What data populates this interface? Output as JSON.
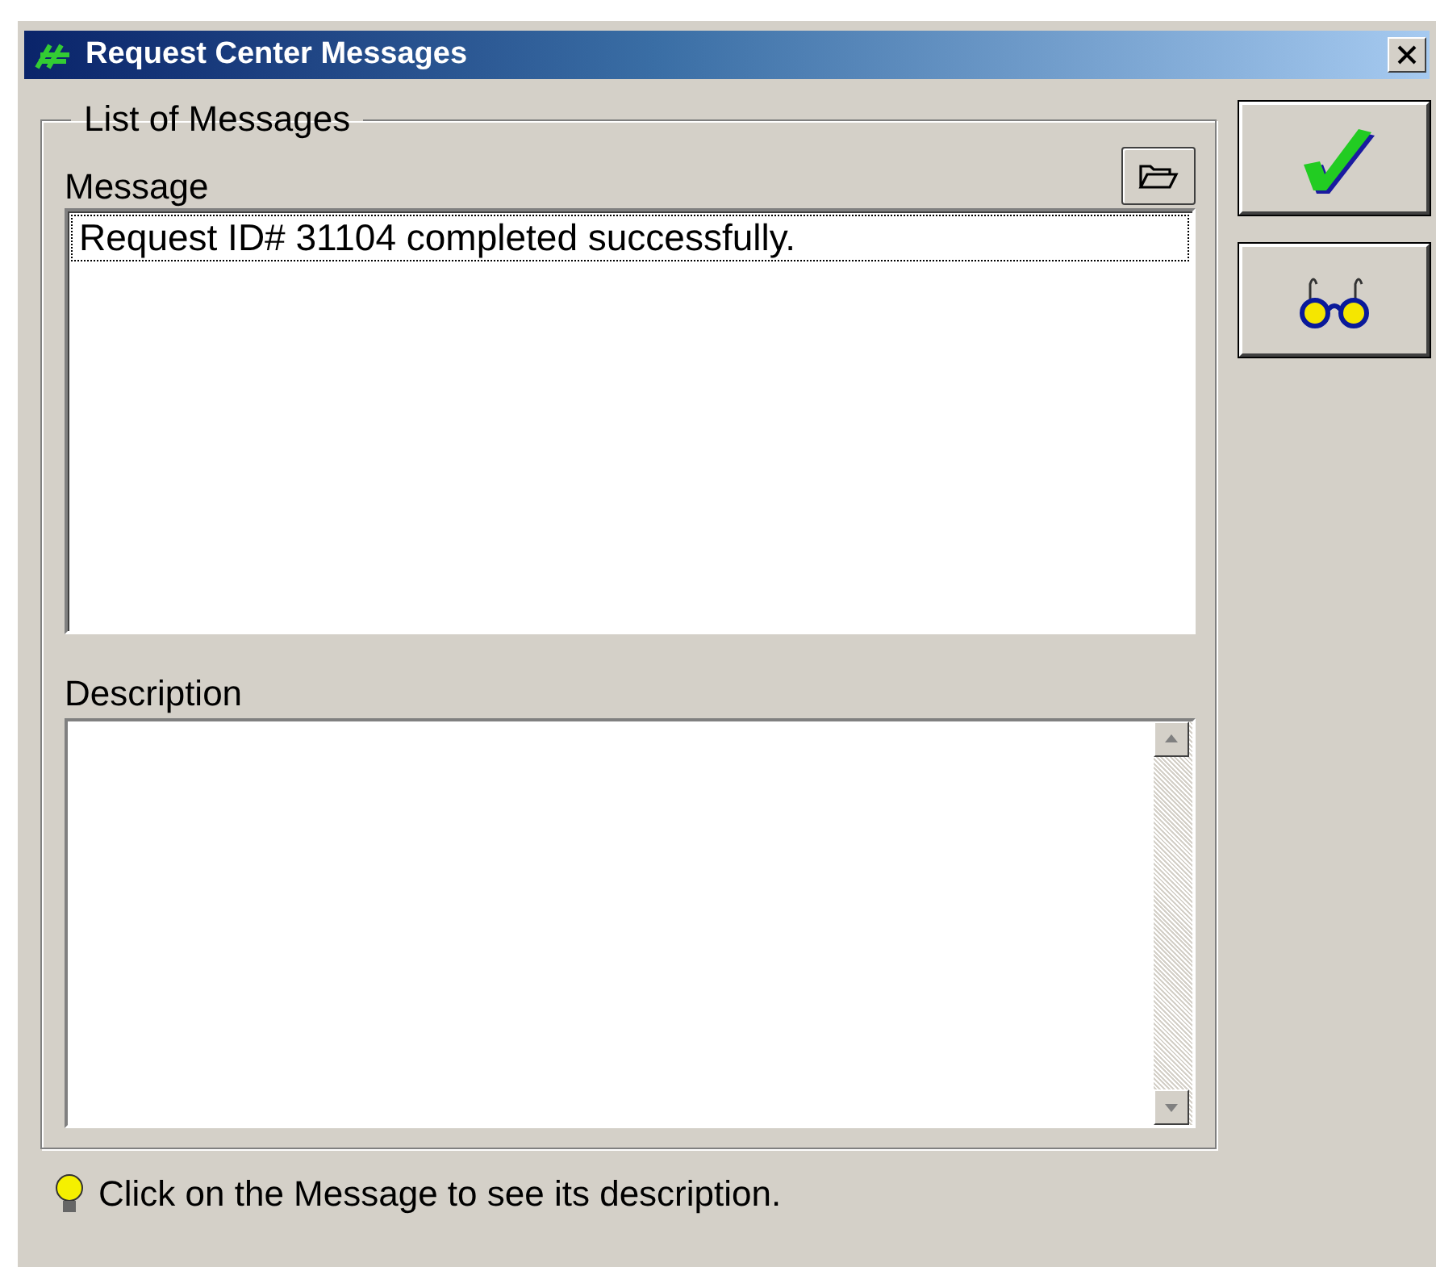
{
  "window": {
    "title": "Request Center Messages"
  },
  "group": {
    "legend": "List of Messages"
  },
  "message_list": {
    "label": "Message",
    "items": [
      {
        "text": "Request ID# 31104 completed successfully.",
        "selected": true
      }
    ]
  },
  "description": {
    "label": "Description"
  },
  "hint": "Click on the Message to see its description."
}
